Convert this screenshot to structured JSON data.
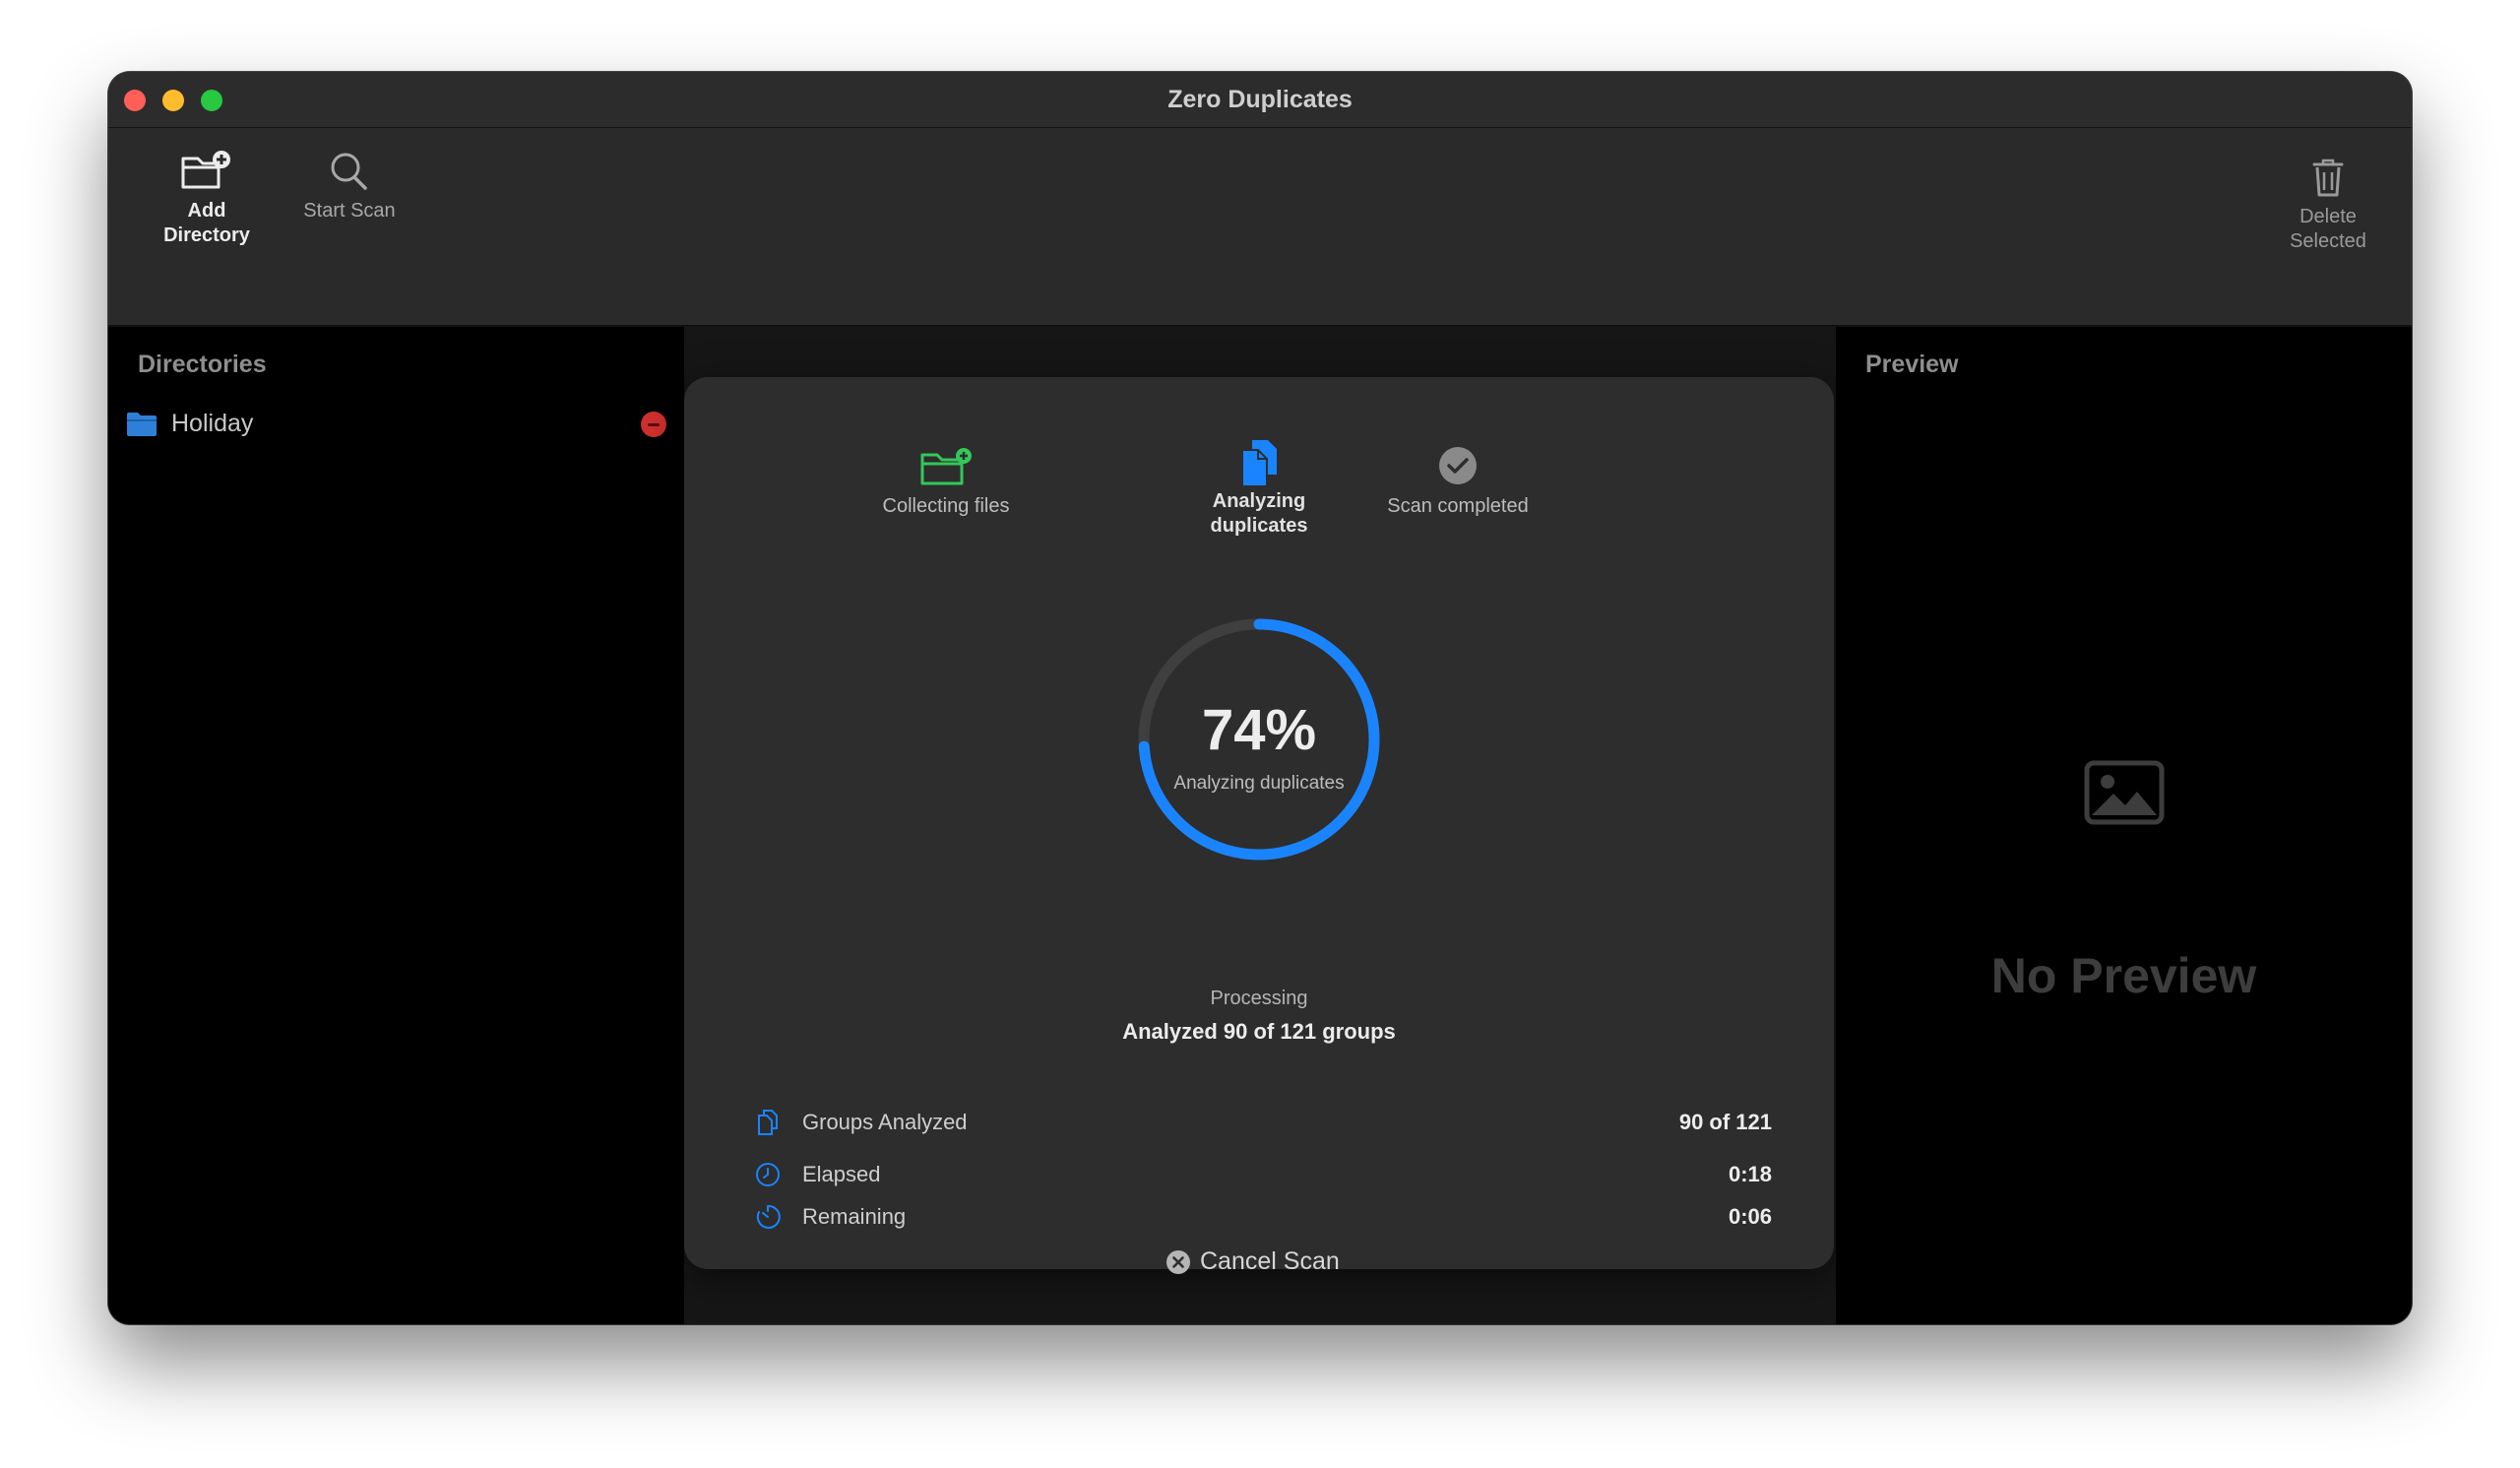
{
  "window": {
    "title": "Zero Duplicates"
  },
  "toolbar": {
    "add_directory": "Add Directory",
    "start_scan": "Start Scan",
    "delete_selected": "Delete Selected"
  },
  "sidebar": {
    "header": "Directories",
    "items": [
      {
        "label": "Holiday"
      }
    ]
  },
  "preview": {
    "header": "Preview",
    "empty_text": "No Preview"
  },
  "scan": {
    "steps": [
      {
        "label": "Collecting files",
        "icon": "folder-badge-plus-icon",
        "state": "done"
      },
      {
        "label": "Analyzing duplicates",
        "icon": "documents-icon",
        "state": "active"
      },
      {
        "label": "Scan completed",
        "icon": "checkmark-circle-icon",
        "state": "pending"
      }
    ],
    "percent": "74%",
    "progress": 0.74,
    "ring_label": "Analyzing duplicates",
    "status_title": "Processing",
    "status_detail": "Analyzed 90 of 121 groups",
    "stats": [
      {
        "label": "Groups Analyzed",
        "value": "90 of 121"
      },
      {
        "label": "Elapsed",
        "value": "0:18"
      },
      {
        "label": "Remaining",
        "value": "0:06"
      }
    ],
    "cancel_label": "Cancel Scan"
  },
  "colors": {
    "accent": "#1a84ff",
    "step_done": "#34c759",
    "close": "#ff5f57",
    "minimize": "#febc2e",
    "maximize": "#28c840",
    "remove": "#d0312d"
  }
}
